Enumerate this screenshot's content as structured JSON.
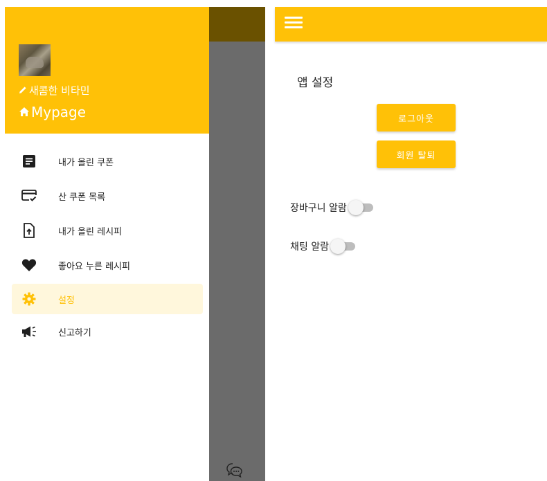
{
  "drawer": {
    "nickname": "새콤한 비타민",
    "mypage": "Mypage",
    "header_color": "#ffc107",
    "items": [
      {
        "label": "내가 올린 쿠폰",
        "icon": "document-icon",
        "active": false
      },
      {
        "label": "산 쿠폰 목록",
        "icon": "card-check-icon",
        "active": false
      },
      {
        "label": "내가 올린 레시피",
        "icon": "upload-file-icon",
        "active": false
      },
      {
        "label": "좋아요 누른 레시피",
        "icon": "heart-icon",
        "active": false
      },
      {
        "label": "설정",
        "icon": "gear-icon",
        "active": true
      },
      {
        "label": "신고하기",
        "icon": "megaphone-icon",
        "active": false
      }
    ]
  },
  "settings": {
    "title": "앱 설정",
    "logout_label": "로그아웃",
    "withdraw_label": "회원 탈퇴",
    "cart_alarm_label": "장바구니 알람",
    "cart_alarm_on": false,
    "chat_alarm_label": "채팅 알람",
    "chat_alarm_on": false,
    "accent_color": "#ffc107"
  }
}
